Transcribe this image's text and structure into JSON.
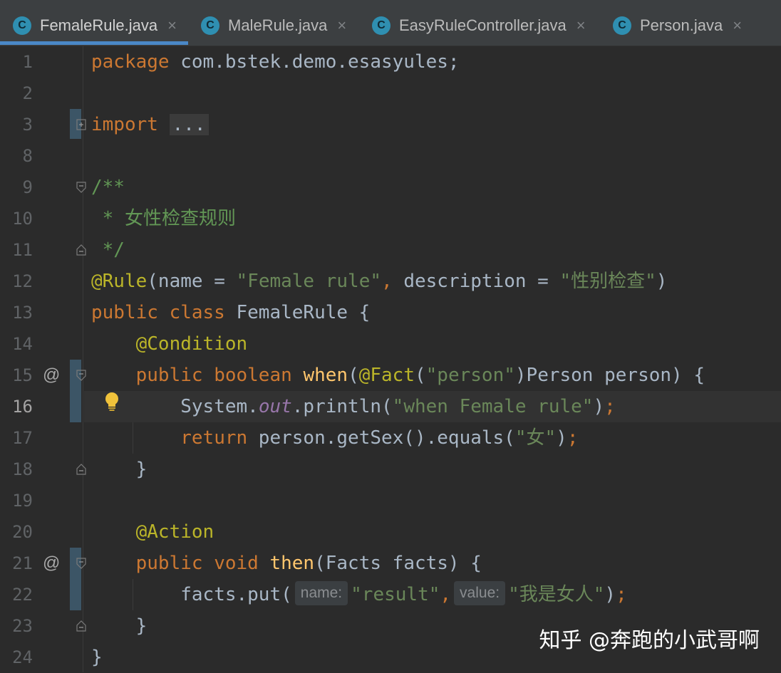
{
  "tabs": [
    {
      "label": "FemaleRule.java",
      "icon": "class-icon",
      "active": true
    },
    {
      "label": "MaleRule.java",
      "icon": "class-icon",
      "active": false
    },
    {
      "label": "EasyRuleController.java",
      "icon": "class-icon",
      "active": false
    },
    {
      "label": "Person.java",
      "icon": "class-icon",
      "active": false
    }
  ],
  "tab_icon_letter": "C",
  "tab_close_glyph": "×",
  "editor": {
    "line_numbers": [
      "1",
      "2",
      "3",
      "8",
      "9",
      "10",
      "11",
      "12",
      "13",
      "14",
      "15",
      "16",
      "17",
      "18",
      "19",
      "20",
      "21",
      "22",
      "23",
      "24"
    ],
    "current_line": "16",
    "gutter_icons": {
      "line15": "@",
      "line21": "@"
    },
    "fold_placeholder": "...",
    "code": {
      "l1_kw": "package",
      "l1_rest": " com.bstek.demo.esasyules;",
      "l3_kw": "import",
      "l9": "/**",
      "l10": " * 女性检查规则",
      "l11": " */",
      "l12_ann": "@Rule",
      "l12_a": "(name = ",
      "l12_s1": "\"Female rule\"",
      "l12_b": ", ",
      "l12_c": "description = ",
      "l12_s2": "\"性别检查\"",
      "l12_d": ")",
      "l13_kw": "public class",
      "l13_rest": " FemaleRule {",
      "l14_ann": "@Condition",
      "l15_kw": "public boolean",
      "l15_fn": "when",
      "l15_a": "(",
      "l15_ann": "@Fact",
      "l15_b": "(",
      "l15_s": "\"person\"",
      "l15_c": ")Person person) {",
      "l16_a": "System.",
      "l16_field": "out",
      "l16_b": ".println(",
      "l16_s": "\"when Female rule\"",
      "l16_c": ")",
      "l16_semi": ";",
      "l17_kw": "return",
      "l17_a": " person.getSex().equals(",
      "l17_s": "\"女\"",
      "l17_b": ")",
      "l17_semi": ";",
      "l18": "}",
      "l20_ann": "@Action",
      "l21_kw": "public void",
      "l21_fn": "then",
      "l21_rest": "(Facts facts) {",
      "l22_a": "facts.put(",
      "l22_hint1": "name:",
      "l22_s1": "\"result\"",
      "l22_comma": ",",
      "l22_hint2": "value:",
      "l22_s2": "\"我是女人\"",
      "l22_b": ")",
      "l22_semi": ";",
      "l23": "}",
      "l24": "}"
    }
  },
  "watermark": "知乎 @奔跑的小武哥啊",
  "colors": {
    "background": "#2b2b2b",
    "keyword": "#cc7832",
    "annotation": "#bbb529",
    "string": "#6a8759",
    "comment": "#629755",
    "method": "#ffc66d",
    "field": "#9876aa",
    "text": "#a9b7c6",
    "tab_underline": "#4a88c7"
  }
}
